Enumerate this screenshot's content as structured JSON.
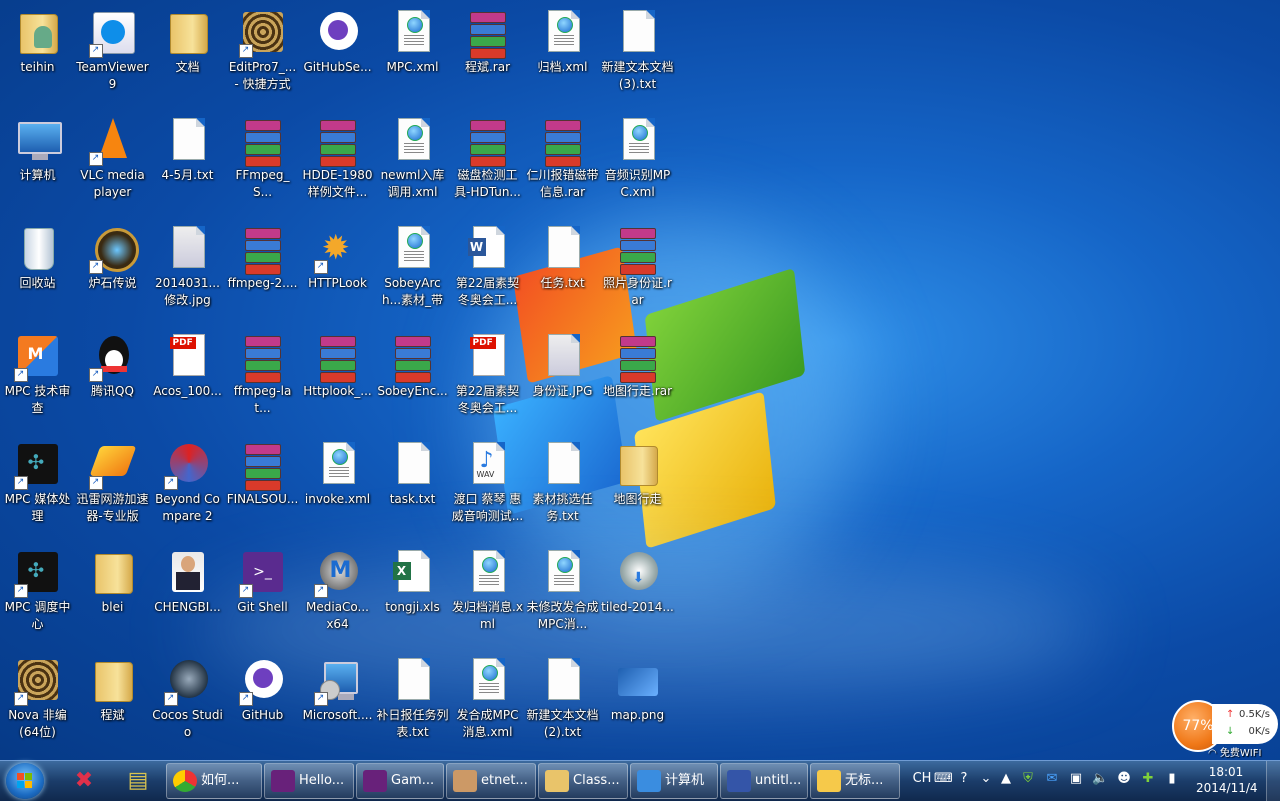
{
  "desktop": {
    "icons": [
      {
        "label": "teihin",
        "icon": "user-folder-icon"
      },
      {
        "label": "TeamViewer 9",
        "icon": "teamviewer-icon",
        "shortcut": true
      },
      {
        "label": "文档",
        "icon": "folder-icon"
      },
      {
        "label": "EditPro7_... - 快捷方式",
        "icon": "editpro-icon",
        "shortcut": true
      },
      {
        "label": "GitHubSe...",
        "icon": "github-icon"
      },
      {
        "label": "MPC.xml",
        "icon": "xml-file-icon"
      },
      {
        "label": "程斌.rar",
        "icon": "rar-archive-icon"
      },
      {
        "label": "归档.xml",
        "icon": "xml-file-icon"
      },
      {
        "label": "新建文本文档 (3).txt",
        "icon": "text-file-icon"
      },
      {
        "label": "计算机",
        "icon": "computer-icon"
      },
      {
        "label": "VLC media player",
        "icon": "vlc-icon",
        "shortcut": true
      },
      {
        "label": "4-5月.txt",
        "icon": "text-file-icon"
      },
      {
        "label": "FFmpeg_S...",
        "icon": "rar-archive-icon"
      },
      {
        "label": "HDDE-1980样例文件...",
        "icon": "rar-archive-icon"
      },
      {
        "label": "newml入库调用.xml",
        "icon": "xml-file-icon"
      },
      {
        "label": "磁盘检测工具-HDTun...",
        "icon": "rar-archive-icon"
      },
      {
        "label": "仁川报错磁带信息.rar",
        "icon": "rar-archive-icon"
      },
      {
        "label": "音频识别MPC.xml",
        "icon": "xml-file-icon"
      },
      {
        "label": "回收站",
        "icon": "recycle-bin-icon"
      },
      {
        "label": "炉石传说",
        "icon": "hearthstone-icon",
        "shortcut": true
      },
      {
        "label": "2014031...修改.jpg",
        "icon": "image-file-icon"
      },
      {
        "label": "ffmpeg-2....",
        "icon": "rar-archive-icon"
      },
      {
        "label": "HTTPLook",
        "icon": "gear-icon",
        "shortcut": true
      },
      {
        "label": "SobeyArch...素材_带节...",
        "icon": "xml-file-icon"
      },
      {
        "label": "第22届素契冬奥会工...",
        "icon": "word-doc-icon"
      },
      {
        "label": "任务.txt",
        "icon": "text-file-icon"
      },
      {
        "label": "照片身份证.rar",
        "icon": "rar-archive-icon"
      },
      {
        "label": "MPC 技术审查",
        "icon": "mpc-app-icon",
        "shortcut": true
      },
      {
        "label": "腾讯QQ",
        "icon": "qq-penguin-icon",
        "shortcut": true
      },
      {
        "label": "Acos_100...",
        "icon": "pdf-file-icon"
      },
      {
        "label": "ffmpeg-lat...",
        "icon": "rar-archive-icon"
      },
      {
        "label": "Httplook_...",
        "icon": "rar-archive-icon"
      },
      {
        "label": "SobeyEnc...",
        "icon": "rar-archive-icon"
      },
      {
        "label": "第22届素契冬奥会工...",
        "icon": "pdf-file-icon"
      },
      {
        "label": "身份证.JPG",
        "icon": "image-file-icon"
      },
      {
        "label": "地图行走.rar",
        "icon": "rar-archive-icon"
      },
      {
        "label": "MPC 媒体处理",
        "icon": "mpc-transform-icon",
        "shortcut": true
      },
      {
        "label": "迅雷网游加速器-专业版",
        "icon": "xunlei-icon",
        "shortcut": true
      },
      {
        "label": "Beyond Compare 2",
        "icon": "beyond-compare-icon",
        "shortcut": true
      },
      {
        "label": "FINALSOU...",
        "icon": "rar-archive-icon"
      },
      {
        "label": "invoke.xml",
        "icon": "xml-file-icon"
      },
      {
        "label": "task.txt",
        "icon": "text-file-icon"
      },
      {
        "label": "渡口 蔡琴 惠威音响测试...",
        "icon": "wav-file-icon"
      },
      {
        "label": "素材挑选任务.txt",
        "icon": "text-file-icon"
      },
      {
        "label": "地图行走",
        "icon": "folder-icon"
      },
      {
        "label": "MPC 调度中心",
        "icon": "mpc-console-icon",
        "shortcut": true
      },
      {
        "label": "blei",
        "icon": "folder-icon"
      },
      {
        "label": "CHENGBI...",
        "icon": "photo-portrait-icon"
      },
      {
        "label": "Git Shell",
        "icon": "git-shell-icon",
        "shortcut": true
      },
      {
        "label": "MediaCo... x64",
        "icon": "media-coder-icon",
        "shortcut": true
      },
      {
        "label": "tongji.xls",
        "icon": "excel-file-icon"
      },
      {
        "label": "发归档消息.xml",
        "icon": "xml-file-icon"
      },
      {
        "label": "未修改发合成MPC消...",
        "icon": "xml-file-icon"
      },
      {
        "label": "tiled-2014...",
        "icon": "tiled-installer-icon"
      },
      {
        "label": "Nova 非编 (64位)",
        "icon": "nova-icon",
        "shortcut": true
      },
      {
        "label": "程斌",
        "icon": "folder-icon"
      },
      {
        "label": "Cocos Studio",
        "icon": "cocos-icon",
        "shortcut": true
      },
      {
        "label": "GitHub",
        "icon": "github-icon",
        "shortcut": true
      },
      {
        "label": "Microsoft....",
        "icon": "installer-icon",
        "shortcut": true
      },
      {
        "label": "补日报任务列表.txt",
        "icon": "text-file-icon"
      },
      {
        "label": "发合成MPC消息.xml",
        "icon": "xml-file-icon"
      },
      {
        "label": "新建文本文档 (2).txt",
        "icon": "text-file-icon"
      },
      {
        "label": "map.png",
        "icon": "png-image-icon"
      }
    ]
  },
  "netwidget": {
    "percent": "77%",
    "up": "0.5K/s",
    "down": "0K/s",
    "wifi_label": "免费WIFI"
  },
  "taskbar": {
    "tasks": [
      {
        "label": "如何...",
        "icon": "chrome-icon"
      },
      {
        "label": "Hello...",
        "icon": "visual-studio-icon"
      },
      {
        "label": "Gam...",
        "icon": "visual-studio-icon"
      },
      {
        "label": "etnet...",
        "icon": "tools-icon"
      },
      {
        "label": "Class...",
        "icon": "folder-icon"
      },
      {
        "label": "计算机",
        "icon": "computer-icon"
      },
      {
        "label": "untitl...",
        "icon": "tiled-icon"
      },
      {
        "label": "无标...",
        "icon": "paint-icon"
      }
    ],
    "tray": {
      "ime": "CH",
      "time": "18:01",
      "date": "2014/11/4"
    }
  }
}
